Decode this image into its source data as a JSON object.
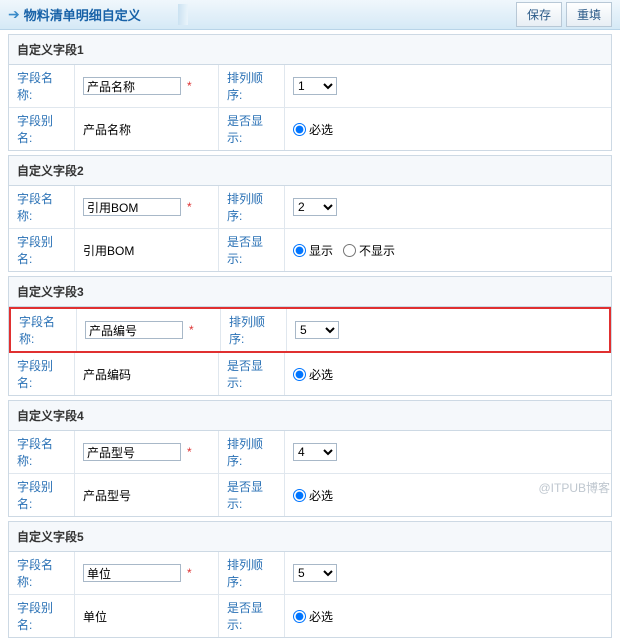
{
  "header": {
    "title": "物料清单明细自定义",
    "save": "保存",
    "reset": "重填"
  },
  "labels": {
    "name": "字段名称:",
    "alias": "字段别名:",
    "order": "排列顺序:",
    "display": "是否显示:",
    "required": "必选",
    "show": "显示",
    "hide": "不显示"
  },
  "sections": [
    {
      "title": "自定义字段1",
      "name": "产品名称",
      "alias": "产品名称",
      "order": "1",
      "displayMode": "required",
      "highlight": false
    },
    {
      "title": "自定义字段2",
      "name": "引用BOM",
      "alias": "引用BOM",
      "order": "2",
      "displayMode": "radio",
      "highlight": false
    },
    {
      "title": "自定义字段3",
      "name": "产品编号",
      "alias": "产品编码",
      "order": "5",
      "displayMode": "required",
      "highlight": true
    },
    {
      "title": "自定义字段4",
      "name": "产品型号",
      "alias": "产品型号",
      "order": "4",
      "displayMode": "required",
      "highlight": false
    },
    {
      "title": "自定义字段5",
      "name": "单位",
      "alias": "单位",
      "order": "5",
      "displayMode": "required",
      "highlight": false
    }
  ],
  "watermark": "@ITPUB博客"
}
